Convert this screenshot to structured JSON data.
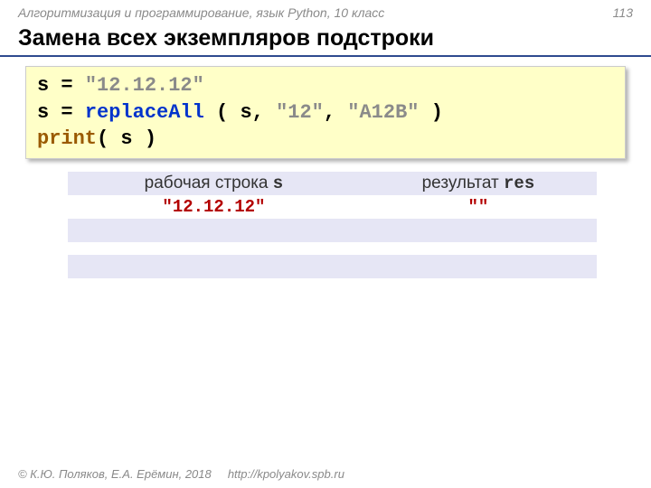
{
  "header": {
    "course": "Алгоритмизация и программирование, язык Python, 10 класс",
    "page": "113"
  },
  "slide_title": "Замена всех экземпляров подстроки",
  "code": {
    "l1": {
      "a": "s = ",
      "b": "\"12.12.12\""
    },
    "l2": {
      "a": "s = ",
      "fn": "replaceAll",
      "b": " ( ",
      "c": "s",
      "d": ", ",
      "e": "\"12\"",
      "f": ", ",
      "g": "\"A12B\"",
      "h": " )"
    },
    "l3": {
      "a": "print",
      "b": "( ",
      "c": "s",
      "d": " )"
    }
  },
  "table": {
    "h1a": "рабочая строка ",
    "h1b": "s",
    "h2a": "результат ",
    "h2b": "res",
    "r1c1": "\"12.12.12\"",
    "r1c2": "\"\"",
    "empty": ""
  },
  "footer": {
    "copyright": "© К.Ю. Поляков, Е.А. Ерёмин, 2018",
    "url": "http://kpolyakov.spb.ru"
  }
}
